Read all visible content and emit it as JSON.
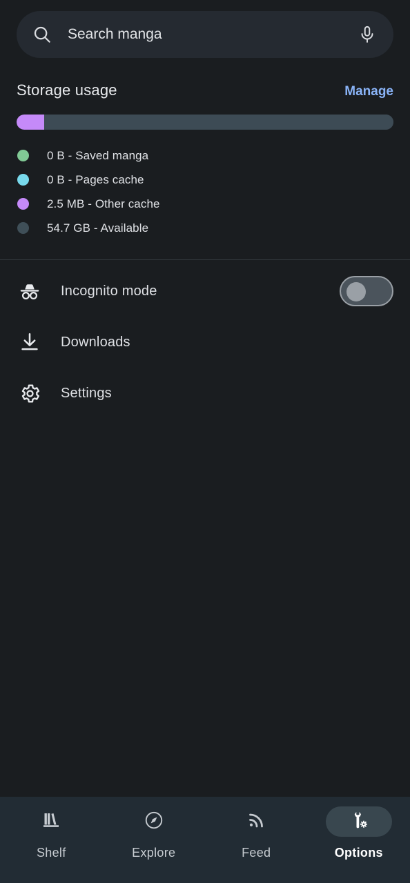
{
  "search": {
    "placeholder": "Search manga",
    "value": "",
    "search_icon": "search-icon",
    "mic_icon": "microphone-icon"
  },
  "storage": {
    "title": "Storage usage",
    "manage_label": "Manage",
    "bar_segments": [
      {
        "name": "Other cache",
        "color": "#c58af9",
        "percent": 7.3
      },
      {
        "name": "Available",
        "color": "#3d4b55",
        "percent": 92.7
      }
    ],
    "legend": [
      {
        "color": "#81c995",
        "label": "0 B - Saved manga"
      },
      {
        "color": "#78d9ec",
        "label": "0 B - Pages cache"
      },
      {
        "color": "#c58af9",
        "label": "2.5 MB - Other cache"
      },
      {
        "color": "#3f4f58",
        "label": "54.7 GB - Available"
      }
    ]
  },
  "menu": {
    "items": [
      {
        "icon": "incognito-icon",
        "label": "Incognito mode",
        "toggle": true,
        "toggle_on": false
      },
      {
        "icon": "download-icon",
        "label": "Downloads",
        "toggle": false
      },
      {
        "icon": "gear-icon",
        "label": "Settings",
        "toggle": false
      }
    ]
  },
  "bottom_nav": {
    "items": [
      {
        "icon": "bookshelf-icon",
        "label": "Shelf",
        "active": false
      },
      {
        "icon": "compass-icon",
        "label": "Explore",
        "active": false
      },
      {
        "icon": "rss-feed-icon",
        "label": "Feed",
        "active": false
      },
      {
        "icon": "wrench-gear-icon",
        "label": "Options",
        "active": true
      }
    ]
  },
  "colors": {
    "background": "#1a1d20",
    "surface": "#252a31",
    "nav_background": "#222c34",
    "accent": "#8ab4f8",
    "active_pill": "#39474f"
  }
}
